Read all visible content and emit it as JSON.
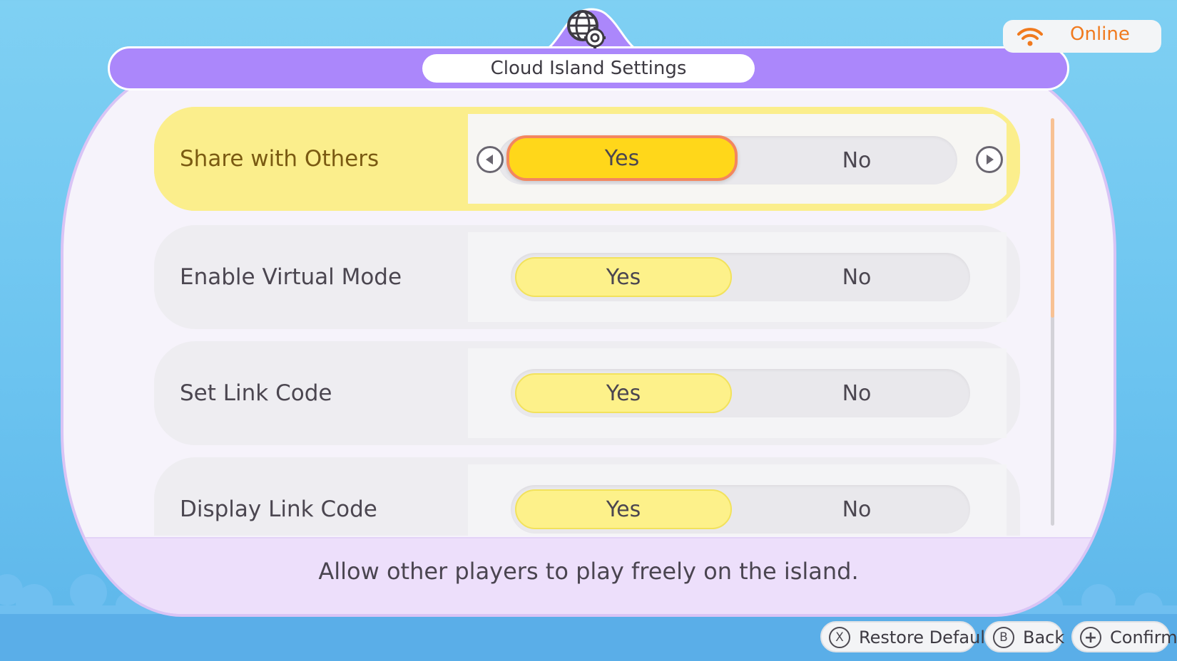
{
  "header": {
    "title": "Cloud Island Settings",
    "icon": "globe-gear-icon"
  },
  "status": {
    "label": "Online",
    "icon": "wifi-icon",
    "color": "#f07a1e"
  },
  "settings": [
    {
      "label": "Share with Others",
      "yes": "Yes",
      "no": "No",
      "value": "Yes",
      "focused": true
    },
    {
      "label": "Enable Virtual Mode",
      "yes": "Yes",
      "no": "No",
      "value": "Yes",
      "focused": false
    },
    {
      "label": "Set Link Code",
      "yes": "Yes",
      "no": "No",
      "value": "Yes",
      "focused": false
    },
    {
      "label": "Display Link Code",
      "yes": "Yes",
      "no": "No",
      "value": "Yes",
      "focused": false
    }
  ],
  "description": "Allow other players to play freely on the island.",
  "actions": [
    {
      "key": "X",
      "label": "Restore Defaults"
    },
    {
      "key": "B",
      "label": "Back"
    },
    {
      "key": "+",
      "label": "Confirm"
    }
  ],
  "colors": {
    "header": "#ab87fb",
    "selected_option": "#ffd71a",
    "option": "#fdf18a",
    "focus_row": "#fbee8c"
  }
}
